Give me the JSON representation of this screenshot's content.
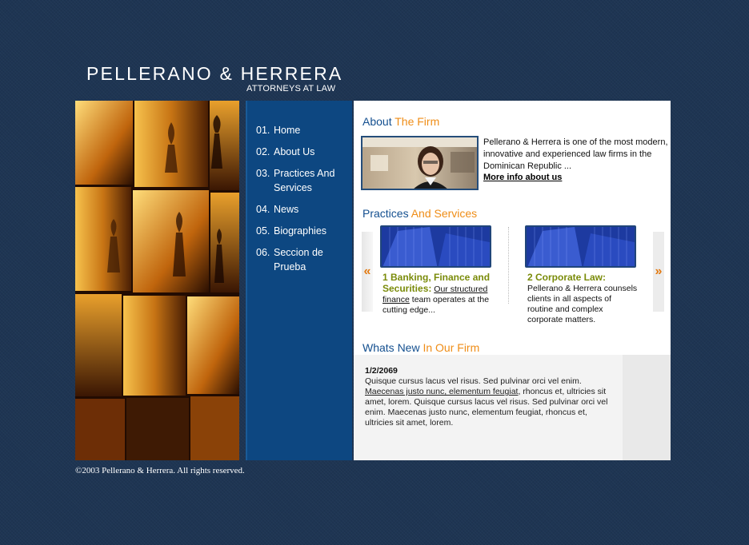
{
  "brand": {
    "name": "PELLERANO & HERRERA",
    "tagline": "ATTORNEYS AT LAW"
  },
  "nav": {
    "items": [
      {
        "num": "01.",
        "label": "Home"
      },
      {
        "num": "02.",
        "label": "About Us"
      },
      {
        "num": "03.",
        "label": "Practices And Services"
      },
      {
        "num": "04.",
        "label": "News"
      },
      {
        "num": "05.",
        "label": "Biographies"
      },
      {
        "num": "06.",
        "label": "Seccion de Prueba"
      }
    ]
  },
  "about": {
    "title_a": "About",
    "title_b": "The Firm",
    "text": "Pellerano & Herrera is one of the most modern, innovative and experienced law firms in the Dominican Republic ...",
    "link": "More info about us"
  },
  "practices": {
    "title_a": "Practices",
    "title_b": "And Services",
    "prev_icon": "«",
    "next_icon": "»",
    "items": [
      {
        "title": "1 Banking, Finance and Securities:",
        "link": "Our structured finance",
        "text": " team operates at the cutting edge..."
      },
      {
        "title": "2 Corporate Law:",
        "link": "",
        "text": "Pellerano & Herrera counsels clients in all aspects of routine and complex corporate matters."
      }
    ]
  },
  "news": {
    "title_a": "Whats New",
    "title_b": "In Our Firm",
    "date": "1/2/2069",
    "text1": "Quisque cursus lacus vel risus. Sed pulvinar orci vel enim.",
    "link": "Maecenas justo nunc, elementum feugiat",
    "text2": ", rhoncus et, ultricies sit amet, lorem. Quisque cursus lacus vel risus. Sed pulvinar orci vel enim. Maecenas justo nunc, elementum feugiat, rhoncus et, ultricies sit amet, lorem."
  },
  "footer": {
    "copyright": "©2003 Pellerano & Herrera. All rights reserved."
  },
  "colors": {
    "background": "#1e3553",
    "nav": "#0d4781",
    "title_blue": "#134f8f",
    "title_orange": "#ef8d17",
    "practice_title": "#7a8b09"
  }
}
